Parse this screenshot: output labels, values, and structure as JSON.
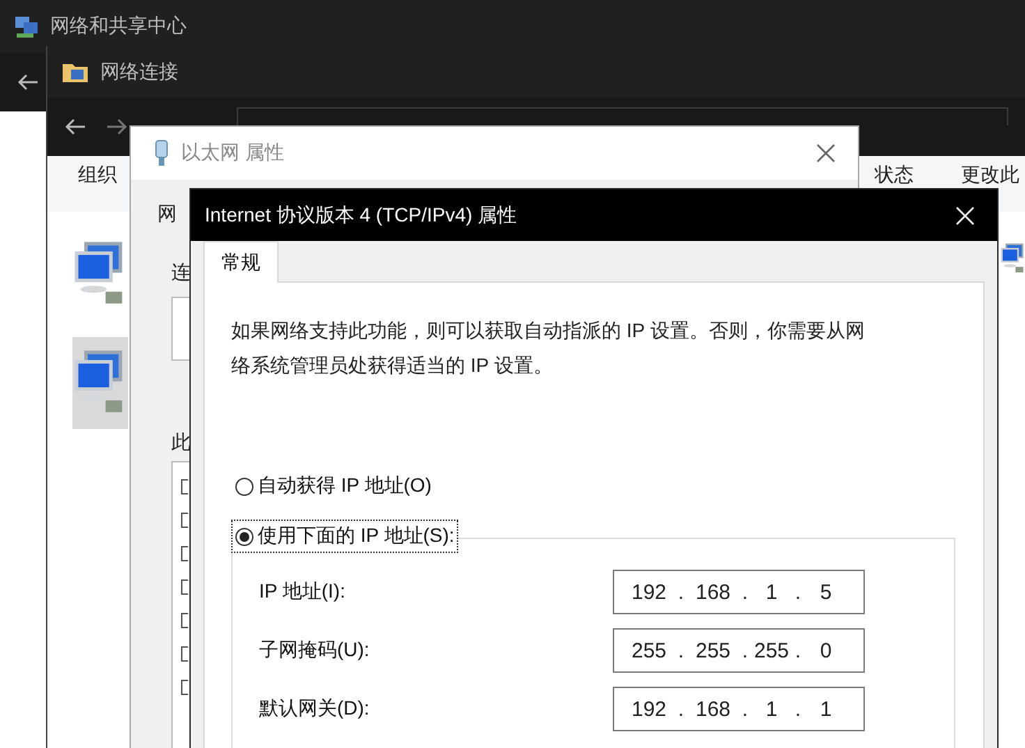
{
  "sharing_center": {
    "title": "网络和共享中心"
  },
  "connections": {
    "title": "网络连接",
    "toolbar_left": "组织",
    "toolbar_right": [
      "状态",
      "更改此"
    ],
    "adapters": [
      {
        "selected": false
      },
      {
        "selected": true
      }
    ]
  },
  "ethernet_properties": {
    "title": "以太网 属性",
    "tab": "网",
    "labels": [
      "连",
      "此"
    ]
  },
  "ipv4_properties": {
    "title": "Internet 协议版本 4 (TCP/IPv4) 属性",
    "tabs": [
      {
        "label": "常规",
        "selected": true
      }
    ],
    "description": "如果网络支持此功能，则可以获取自动指派的 IP 设置。否则，你需要从网络系统管理员处获得适当的 IP 设置。",
    "options": [
      {
        "label": "自动获得 IP 地址(O)",
        "selected": false
      },
      {
        "label": "使用下面的 IP 地址(S):",
        "selected": true
      }
    ],
    "fields": [
      {
        "label": "IP 地址(I):",
        "parts": [
          "192",
          ".",
          "168",
          ".",
          "1",
          ".",
          "5"
        ]
      },
      {
        "label": "子网掩码(U):",
        "parts": [
          "255",
          ".",
          "255",
          ".",
          "255",
          ".",
          "0"
        ]
      },
      {
        "label": "默认网关(D):",
        "parts": [
          "192",
          ".",
          "168",
          ".",
          "1",
          ".",
          "1"
        ]
      }
    ]
  }
}
